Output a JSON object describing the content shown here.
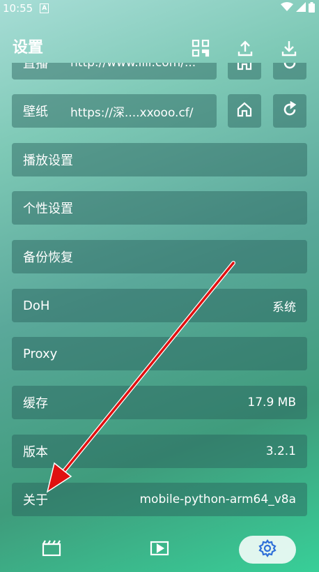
{
  "status_bar": {
    "time": "10:55",
    "notification_letter": "A"
  },
  "header": {
    "title": "设置"
  },
  "settings": {
    "partial_row": {
      "label": "直播",
      "value": "http://www.liii.com/..."
    },
    "wallpaper": {
      "label": "壁纸",
      "value": "https://深....xxooo.cf/"
    },
    "playback": {
      "label": "播放设置"
    },
    "personalization": {
      "label": "个性设置"
    },
    "backup": {
      "label": "备份恢复"
    },
    "doh": {
      "label": "DoH",
      "value": "系统"
    },
    "proxy": {
      "label": "Proxy"
    },
    "cache": {
      "label": "缓存",
      "value": "17.9 MB"
    },
    "version": {
      "label": "版本",
      "value": "3.2.1"
    },
    "about": {
      "label": "关于",
      "value": "mobile-python-arm64_v8a"
    }
  },
  "icons": [
    "qrcode-icon",
    "upload-icon",
    "download-icon",
    "home-icon",
    "refresh-icon",
    "film-icon",
    "play-icon",
    "gear-icon"
  ],
  "colors": {
    "accent_arrow": "#e01010",
    "row_bg": "rgba(40,95,90,0.45)",
    "active_nav_bg": "#ffffff",
    "active_icon": "#2e6fd8"
  }
}
